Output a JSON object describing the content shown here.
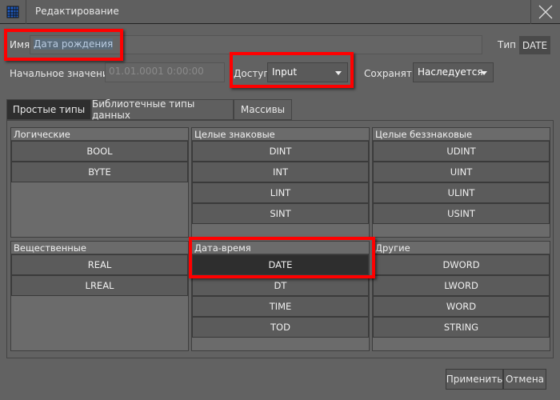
{
  "window": {
    "title": "Редактирование",
    "icon": "grid-table-icon",
    "close_icon": "close-icon"
  },
  "form": {
    "name_label": "Имя",
    "name_value": "Дата рождения",
    "type_label": "Тип",
    "type_value": "DATE",
    "initial_label": "Начальное значение",
    "initial_value": "01.01.0001 0:00:00",
    "access_label": "Доступ",
    "access_value": "Input",
    "save_label": "Сохранять",
    "save_value": "Наследуется"
  },
  "tabs": [
    {
      "label": "Простые типы",
      "active": true
    },
    {
      "label": "Библиотечные типы данных"
    },
    {
      "label": "Массивы"
    }
  ],
  "groups": [
    {
      "title": "Логические",
      "items": [
        "BOOL",
        "BYTE"
      ]
    },
    {
      "title": "Целые знаковые",
      "items": [
        "DINT",
        "INT",
        "LINT",
        "SINT"
      ]
    },
    {
      "title": "Целые беззнаковые",
      "items": [
        "UDINT",
        "UINT",
        "ULINT",
        "USINT"
      ]
    },
    {
      "title": "Вещественные",
      "items": [
        "REAL",
        "LREAL"
      ]
    },
    {
      "title": "Дата-время",
      "items": [
        "DATE",
        "DT",
        "TIME",
        "TOD"
      ]
    },
    {
      "title": "Другие",
      "items": [
        "DWORD",
        "LWORD",
        "WORD",
        "STRING"
      ]
    }
  ],
  "selected_type": "DATE",
  "buttons": {
    "apply": "Применить",
    "cancel": "Отмена"
  },
  "colors": {
    "highlight": "#ff0000",
    "selected": "#2e2e2e",
    "accent_icon": "#2a6fd6"
  }
}
